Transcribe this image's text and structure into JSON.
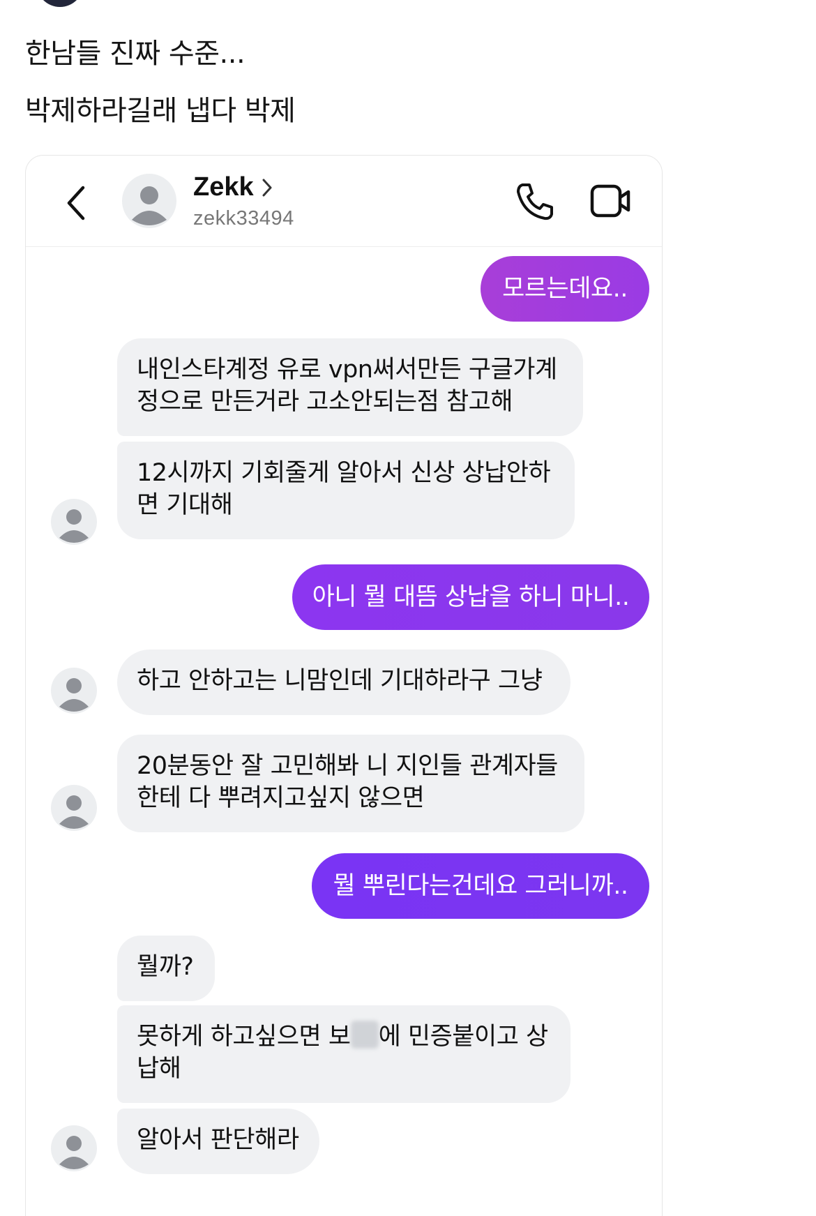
{
  "post": {
    "line1": "한남들 진짜 수준...",
    "line2": "박제하라길래 냅다 박제"
  },
  "header": {
    "name": "Zekk",
    "handle": "zekk33494"
  },
  "colors": {
    "out_gradient_1": "#a83ed8",
    "out_gradient_2": "#8c36f0",
    "out_gradient_3": "#7a34f4",
    "in_bubble": "#f0f1f3"
  },
  "messages": [
    {
      "from": "me",
      "text": "모르는데요.."
    },
    {
      "from": "them",
      "line1": "내인스타계정 유로 vpn써서만든 구글가계",
      "line2": "정으로 만든거라 고소안되는점 참고해"
    },
    {
      "from": "them",
      "line1": "12시까지 기회줄게 알아서 신상 상납안하",
      "line2": "면 기대해"
    },
    {
      "from": "me",
      "text": "아니 뭘 대뜸 상납을 하니 마니.."
    },
    {
      "from": "them",
      "text": "하고 안하고는 니맘인데 기대하라구 그냥"
    },
    {
      "from": "them",
      "line1": "20분동안 잘 고민해봐 니 지인들 관계자들",
      "line2": "한테 다 뿌려지고싶지 않으면"
    },
    {
      "from": "me",
      "text": "뭘 뿌린다는건데요 그러니까.."
    },
    {
      "from": "them",
      "text": "뭘까?"
    },
    {
      "from": "them",
      "line1a": "못하게 하고싶으면 보",
      "line1b": "에 민증붙이고 상",
      "line2": "납해"
    },
    {
      "from": "them",
      "text": "알아서 판단해라"
    }
  ]
}
